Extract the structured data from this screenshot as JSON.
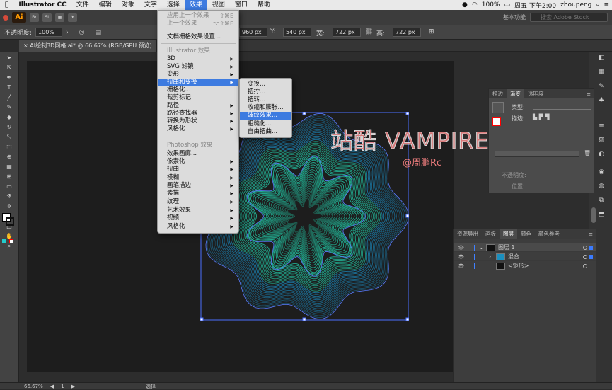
{
  "mac_menubar": {
    "app_name": "Illustrator CC",
    "items": [
      "文件",
      "编辑",
      "对象",
      "文字",
      "选择",
      "效果",
      "视图",
      "窗口",
      "帮助"
    ],
    "active_item": "效果",
    "battery": "100%",
    "clock": "周五 下午2:00",
    "user": "zhoupeng"
  },
  "app_toolbar": {
    "logo": "Ai",
    "bridge_label": "Br",
    "stock_label": "St",
    "workspace": "基本功能",
    "stock_search_placeholder": "搜索 Adobe Stock"
  },
  "control_bar": {
    "opacity_label": "不透明度:",
    "opacity_value": "100%",
    "w_value": "960 px",
    "y_label": "Y:",
    "y_value": "540 px",
    "w_label": "宽:",
    "width_value": "722 px",
    "h_label": "高:",
    "height_value": "722 px"
  },
  "doc_tab": {
    "title": "AI绘制3D网格.ai* @ 66.67% (RGB/GPU 预览)"
  },
  "effect_menu": {
    "apply_last": "应用上一个效果",
    "apply_last_shortcut": "⇧⌘E",
    "last": "上一个效果",
    "last_shortcut": "⌥⇧⌘E",
    "raster_settings": "文档栅格效果设置...",
    "illustrator_header": "Illustrator 效果",
    "illustrator_items": [
      "3D",
      "SVG 滤镜",
      "变形",
      "扭曲和变换",
      "栅格化...",
      "裁剪标记",
      "路径",
      "路径查找器",
      "转换为形状",
      "风格化"
    ],
    "photoshop_header": "Photoshop 效果",
    "photoshop_items": [
      "效果画廊...",
      "像素化",
      "扭曲",
      "模糊",
      "画笔描边",
      "素描",
      "纹理",
      "艺术效果",
      "视频",
      "风格化"
    ]
  },
  "distort_submenu": {
    "items": [
      "变换...",
      "扭拧...",
      "扭转...",
      "收缩和膨胀...",
      "波纹效果...",
      "粗糙化...",
      "自由扭曲..."
    ],
    "highlighted": "波纹效果..."
  },
  "watermark": {
    "title": "站酷 VAMPIREE",
    "author": "@周鹏Rc"
  },
  "stroke_panel": {
    "tabs": [
      "描边",
      "渐变",
      "透明度"
    ],
    "active_tab": "渐变",
    "type_label": "类型:",
    "stroke_label": "描边:",
    "opacity_label": "不透明度:",
    "position_label": "位置:"
  },
  "layers_panel": {
    "tabs": [
      "资源导出",
      "画板",
      "图层",
      "颜色",
      "颜色参考"
    ],
    "active_tab": "图层",
    "rows": [
      {
        "name": "图层 1"
      },
      {
        "name": "混合"
      },
      {
        "name": "<矩形>"
      }
    ]
  },
  "status_bar": {
    "zoom": "66.67%",
    "page": "1",
    "tool_status": "选择"
  },
  "colors": {
    "accent": "#3d7be0",
    "flower_outer": "#1aa0e0",
    "flower_inner": "#22c0a0",
    "watermark": "#ff8c8c"
  }
}
